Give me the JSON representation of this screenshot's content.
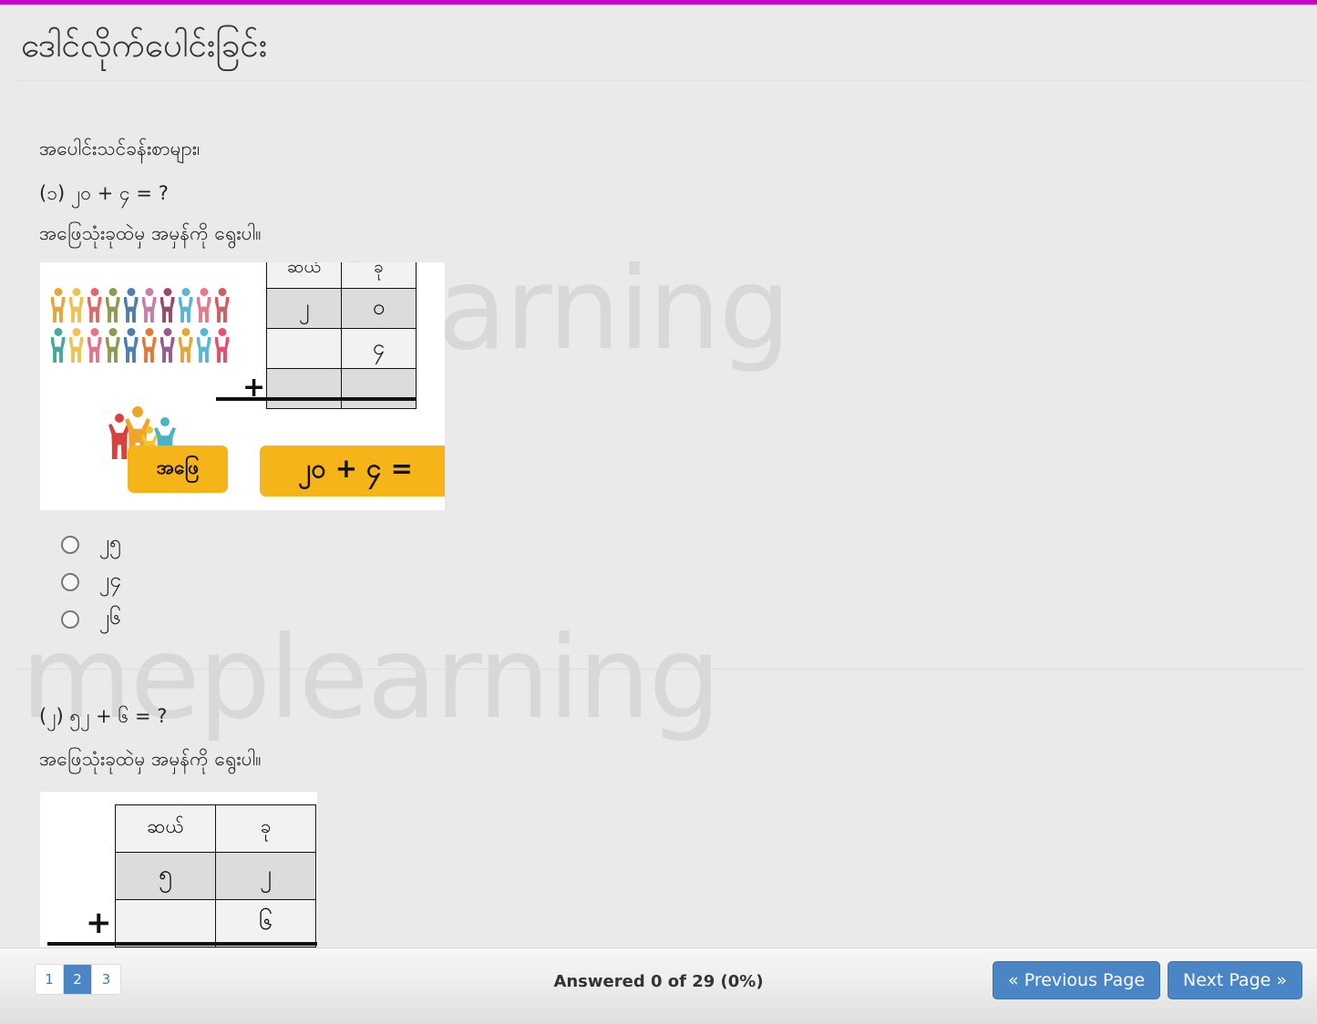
{
  "theme": {
    "accent_magenta": "#cc00cc",
    "page_background": "#eaeaea",
    "button_blue": "#4a86c5",
    "answer_button_yellow": "#f5b417",
    "watermark_gray": "#d8d8d8"
  },
  "header": {
    "title": "ဒေါင်လိုက်ပေါင်းခြင်း"
  },
  "watermark": {
    "text": "meplearning"
  },
  "quiz": {
    "intro": "အပေါင်းသင်ခန်းစာများ၊",
    "questions": [
      {
        "number_label": "(၁)",
        "prompt": "(၁) ၂၀ + ၄ = ?",
        "instruction": "အဖြေသုံးခုထဲမှ အမှန်ကို ရွေးပါ။",
        "stimulus": {
          "people_top_count": 10,
          "people_bottom_count": 10,
          "family_count": 4,
          "table": {
            "headers": [
              "ဆယ်",
              "ခု"
            ],
            "rows": [
              [
                "၂",
                "၀"
              ],
              [
                "",
                "၄"
              ],
              [
                "",
                ""
              ]
            ],
            "operator": "+"
          },
          "buttons": {
            "answer_label": "အဖြေ",
            "equation_label": "၂၀ + ၄ ="
          }
        },
        "options": [
          {
            "value": "၂၅",
            "selected": false
          },
          {
            "value": "၂၄",
            "selected": false
          },
          {
            "value": "၂၆",
            "selected": false
          }
        ]
      },
      {
        "number_label": "(၂)",
        "prompt": "(၂) ၅၂ + ၆ = ?",
        "instruction": "အဖြေသုံးခုထဲမှ အမှန်ကို ရွေးပါ။",
        "stimulus": {
          "table": {
            "headers": [
              "ဆယ်",
              "ခု"
            ],
            "rows": [
              [
                "၅",
                "၂"
              ],
              [
                "",
                "၆"
              ],
              [
                "",
                ""
              ]
            ],
            "operator": "+"
          }
        }
      }
    ]
  },
  "footer": {
    "pagination": [
      {
        "label": "1",
        "active": false
      },
      {
        "label": "2",
        "active": true
      },
      {
        "label": "3",
        "active": false
      }
    ],
    "status": "Answered 0 of 29 (0%)",
    "previous_label": "« Previous Page",
    "next_label": "Next Page »"
  },
  "people_colors": {
    "top": [
      "#e4a83a",
      "#f0c24f",
      "#e06a6a",
      "#8f9b52",
      "#4f7fae",
      "#c97fa5",
      "#9a4a66",
      "#5bb5d6",
      "#e47a8e",
      "#cf5f63"
    ],
    "bottom": [
      "#49a89d",
      "#f0c24f",
      "#e4738c",
      "#8f9b52",
      "#4f7fae",
      "#e07b3c",
      "#9a5a8e",
      "#e4a83a",
      "#5bb5d6",
      "#e4506b"
    ],
    "family": [
      "#d9413f",
      "#f0a52a",
      "#f2c530",
      "#4bb3c4"
    ]
  }
}
